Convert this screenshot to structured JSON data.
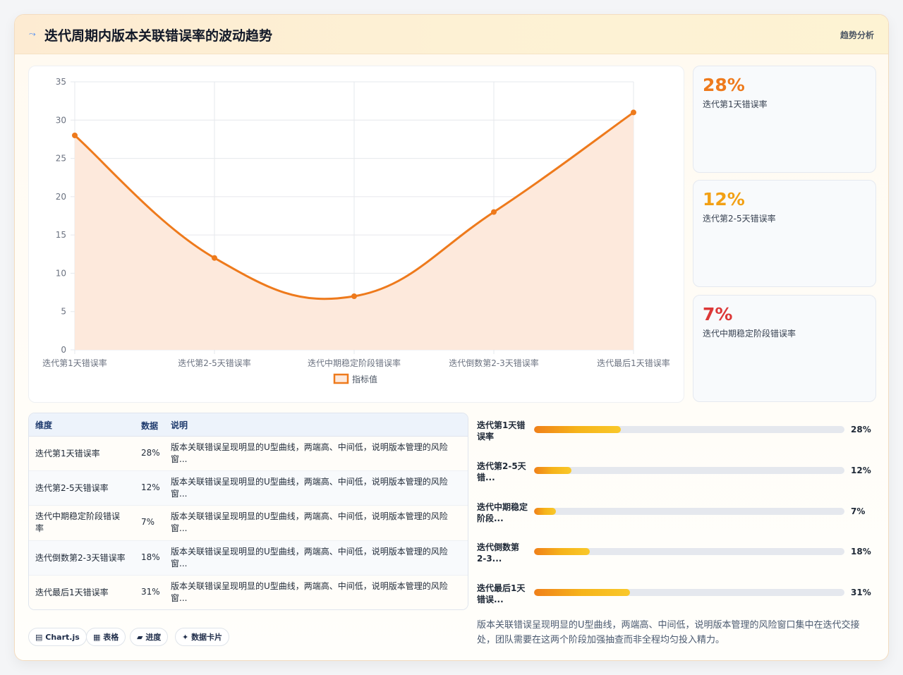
{
  "header": {
    "icon": "chart-line-icon",
    "title": "迭代周期内版本关联错误率的波动趋势",
    "tag": "趋势分析"
  },
  "chart_data": {
    "type": "line",
    "categories": [
      "迭代第1天错误率",
      "迭代第2-5天错误率",
      "迭代中期稳定阶段错误率",
      "迭代倒数第2-3天错误率",
      "迭代最后1天错误率"
    ],
    "series": [
      {
        "name": "指标值",
        "values": [
          28,
          12,
          7,
          18,
          31
        ]
      }
    ],
    "ylim": [
      0,
      35
    ],
    "yticks": [
      "0",
      "5",
      "10",
      "15",
      "20",
      "25",
      "30",
      "35"
    ],
    "grid": true,
    "fill": true,
    "legend": "bottom",
    "colors": {
      "line": "#ee7a1c",
      "fill": "#fde9dc"
    }
  },
  "kpis": [
    {
      "value": "28%",
      "label": "迭代第1天错误率",
      "color": "#ee7a1c"
    },
    {
      "value": "12%",
      "label": "迭代第2-5天错误率",
      "color": "#f2a014"
    },
    {
      "value": "7%",
      "label": "迭代中期稳定阶段错误率",
      "color": "#dc3838"
    }
  ],
  "table": {
    "headers": [
      "维度",
      "数据",
      "说明"
    ],
    "rows": [
      {
        "dim": "迭代第1天错误率",
        "val": "28%",
        "desc": "版本关联错误呈现明显的U型曲线，两端高、中间低，说明版本管理的风险窗..."
      },
      {
        "dim": "迭代第2-5天错误率",
        "val": "12%",
        "desc": "版本关联错误呈现明显的U型曲线，两端高、中间低，说明版本管理的风险窗..."
      },
      {
        "dim": "迭代中期稳定阶段错误率",
        "val": "7%",
        "desc": "版本关联错误呈现明显的U型曲线，两端高、中间低，说明版本管理的风险窗..."
      },
      {
        "dim": "迭代倒数第2-3天错误率",
        "val": "18%",
        "desc": "版本关联错误呈现明显的U型曲线，两端高、中间低，说明版本管理的风险窗..."
      },
      {
        "dim": "迭代最后1天错误率",
        "val": "31%",
        "desc": "版本关联错误呈现明显的U型曲线，两端高、中间低，说明版本管理的风险窗..."
      }
    ]
  },
  "progress": [
    {
      "label": "迭代第1天错误率",
      "value": "28%",
      "fraction": 0.28
    },
    {
      "label": "迭代第2-5天错...",
      "value": "12%",
      "fraction": 0.12
    },
    {
      "label": "迭代中期稳定阶段...",
      "value": "7%",
      "fraction": 0.07
    },
    {
      "label": "迭代倒数第2-3...",
      "value": "18%",
      "fraction": 0.18
    },
    {
      "label": "迭代最后1天错误...",
      "value": "31%",
      "fraction": 0.31
    }
  ],
  "chips": [
    {
      "icon": "bar-chart-icon",
      "label": "Chart.js"
    },
    {
      "icon": "table-icon",
      "label": "表格"
    },
    {
      "icon": "progress-icon",
      "label": "进度"
    },
    {
      "icon": "sparkle-icon",
      "label": "数据卡片"
    }
  ],
  "summary": "版本关联错误呈现明显的U型曲线，两端高、中间低，说明版本管理的风险窗口集中在迭代交接处，团队需要在这两个阶段加强抽查而非全程均匀投入精力。"
}
